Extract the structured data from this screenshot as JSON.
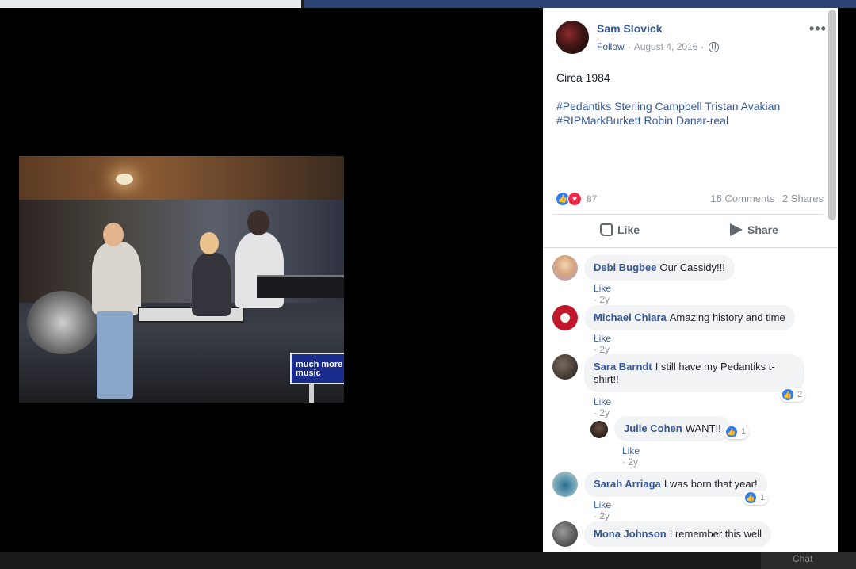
{
  "background": {
    "chat_label": "Chat"
  },
  "photo": {
    "logo_text": "much more music"
  },
  "post": {
    "author": "Sam Slovick",
    "follow": "Follow",
    "separator": "·",
    "date": "August 4, 2016",
    "privacy_icon": "globe-icon",
    "more_icon": "more-options-icon",
    "caption": "Circa 1984",
    "tags_line1": "#Pedantiks Sterling Campbell Tristan Avakian",
    "tags_line2": "#RIPMarkBurkett Robin Danar-real",
    "reaction_count": "87",
    "comments_count": "16 Comments",
    "shares_count": "2 Shares",
    "like_label": "Like",
    "share_label": "Share"
  },
  "comments": [
    {
      "name": "Debi Bugbee",
      "text": "Our Cassidy!!!",
      "like": "Like",
      "age": "2y"
    },
    {
      "name": "Michael Chiara",
      "text": "Amazing history and time",
      "like": "Like",
      "age": "2y"
    },
    {
      "name": "Sara Barndt",
      "text": "I still have my Pedantiks t-shirt!!",
      "like": "Like",
      "age": "2y",
      "reactions": "2"
    },
    {
      "name": "Julie Cohen",
      "text": "WANT!!",
      "like": "Like",
      "age": "2y",
      "reactions": "1"
    },
    {
      "name": "Sarah Arriaga",
      "text": "I was born that year!",
      "like": "Like",
      "age": "2y",
      "reactions": "1"
    },
    {
      "name": "Mona Johnson",
      "text": "I remember this well"
    }
  ],
  "colors": {
    "link_blue": "#365899",
    "like_blue": "#2e7cf6",
    "love_red": "#f0284a",
    "bubble_gray": "#f2f3f5"
  }
}
